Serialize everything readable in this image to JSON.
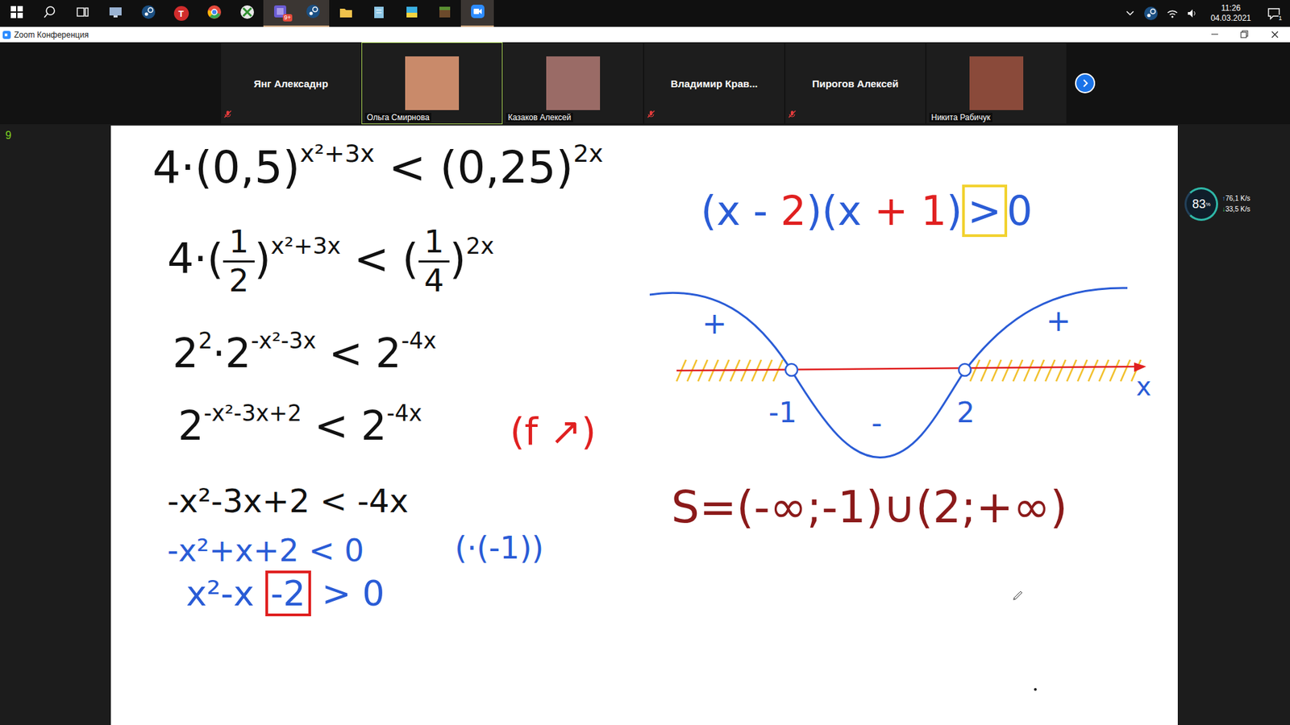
{
  "taskbar": {
    "apps": [
      {
        "kind": "start",
        "active": false
      },
      {
        "kind": "search",
        "active": false
      },
      {
        "kind": "taskview",
        "active": false
      },
      {
        "kind": "monitor",
        "active": false
      },
      {
        "kind": "steam",
        "active": false
      },
      {
        "kind": "letter",
        "label": "T",
        "active": false
      },
      {
        "kind": "chrome",
        "active": false
      },
      {
        "kind": "xbox",
        "active": false
      },
      {
        "kind": "badge",
        "badge": "9+",
        "active": true
      },
      {
        "kind": "steam",
        "active": true
      },
      {
        "kind": "folder",
        "active": false
      },
      {
        "kind": "notes",
        "active": false
      },
      {
        "kind": "paint",
        "active": false
      },
      {
        "kind": "block",
        "active": false
      },
      {
        "kind": "zoom",
        "active": true
      }
    ],
    "time": "11:26",
    "date": "04.03.2021",
    "notifications": "1"
  },
  "window": {
    "title": "Zoom Конференция"
  },
  "side_marker": "9",
  "participants": [
    {
      "name": "Янг Алексаднр",
      "video": false,
      "muted": true,
      "selected": false
    },
    {
      "name": "Ольга Смирнова",
      "video": true,
      "muted": false,
      "selected": true,
      "color": "#c98a6a"
    },
    {
      "name": "Казаков Алексей",
      "video": true,
      "muted": false,
      "selected": false,
      "color": "#9a6b66"
    },
    {
      "name": "Владимир  Крав...",
      "video": false,
      "muted": true,
      "selected": false
    },
    {
      "name": "Пирогов Алексей",
      "video": false,
      "muted": true,
      "selected": false
    },
    {
      "name": "Никита Рабичук",
      "video": true,
      "muted": false,
      "selected": false,
      "color": "#8a4a3a"
    }
  ],
  "network": {
    "percent": "83",
    "percent_sign": "%",
    "up_arrow": "↑",
    "up": "76,1 K/s",
    "down_arrow": "↓",
    "down": "33,5 K/s"
  },
  "board": {
    "items": [
      {
        "segments": [
          {
            "k": "base",
            "t": "4·(0,5)",
            "color": "#111111"
          },
          {
            "k": "sup",
            "t": "x²+3x",
            "color": "#111111"
          },
          {
            "k": "base",
            "t": " < (0,25)",
            "color": "#111111"
          },
          {
            "k": "sup",
            "t": "2x",
            "color": "#111111"
          }
        ]
      },
      {
        "segments": [
          {
            "k": "base",
            "t": "4·(",
            "color": "#111111"
          },
          {
            "k": "frac",
            "num": "1",
            "den": "2",
            "color": "#111111"
          },
          {
            "k": "base",
            "t": ")",
            "color": "#111111"
          },
          {
            "k": "sup",
            "t": "x²+3x",
            "color": "#111111"
          },
          {
            "k": "base",
            "t": "  < (",
            "color": "#111111"
          },
          {
            "k": "frac",
            "num": "1",
            "den": "4",
            "color": "#111111"
          },
          {
            "k": "base",
            "t": ")",
            "color": "#111111"
          },
          {
            "k": "sup",
            "t": "2x",
            "color": "#111111"
          }
        ]
      },
      {
        "segments": [
          {
            "k": "base",
            "t": "2",
            "color": "#111111"
          },
          {
            "k": "sup",
            "t": "2",
            "color": "#111111"
          },
          {
            "k": "base",
            "t": "·2",
            "color": "#111111"
          },
          {
            "k": "sup",
            "t": "-x²-3x",
            "color": "#111111"
          },
          {
            "k": "base",
            "t": "  < 2",
            "color": "#111111"
          },
          {
            "k": "sup",
            "t": "-4x",
            "color": "#111111"
          }
        ]
      },
      {
        "segments": [
          {
            "k": "base",
            "t": "2",
            "color": "#111111"
          },
          {
            "k": "sup",
            "t": "-x²-3x+2",
            "color": "#111111"
          },
          {
            "k": "base",
            "t": "   < 2",
            "color": "#111111"
          },
          {
            "k": "sup",
            "t": "-4x",
            "color": "#111111"
          }
        ]
      },
      {
        "segments": [
          {
            "k": "base",
            "t": "(f ↗)",
            "color": "#e02020"
          }
        ]
      },
      {
        "segments": [
          {
            "k": "base",
            "t": "-x²-3x+2 < -4x",
            "color": "#111111"
          }
        ]
      },
      {
        "segments": [
          {
            "k": "base",
            "t": "-x²+x+2 < 0",
            "color": "#2a5cd6"
          }
        ]
      },
      {
        "segments": [
          {
            "k": "base",
            "t": "(·(-1))",
            "color": "#2a5cd6"
          }
        ]
      },
      {
        "segments": [
          {
            "k": "base",
            "t": "x²-x ",
            "color": "#2a5cd6"
          },
          {
            "k": "box",
            "t": "-2",
            "color": "#2a5cd6",
            "box_color": "#e02020"
          },
          {
            "k": "base",
            "t": " > 0",
            "color": "#2a5cd6"
          }
        ]
      },
      {
        "segments": [
          {
            "k": "base",
            "t": "(x - ",
            "color": "#2a5cd6"
          },
          {
            "k": "base",
            "t": "2",
            "color": "#e02020"
          },
          {
            "k": "base",
            "t": ")(x ",
            "color": "#2a5cd6"
          },
          {
            "k": "base",
            "t": "+ 1",
            "color": "#e02020"
          },
          {
            "k": "base",
            "t": ")",
            "color": "#2a5cd6"
          },
          {
            "k": "box",
            "t": ">",
            "color": "#2a5cd6",
            "box_color": "#f2d230"
          },
          {
            "k": "base",
            "t": "0",
            "color": "#2a5cd6"
          }
        ]
      },
      {
        "segments": [
          {
            "k": "base",
            "t": "S=(-∞;-1)∪(2;+∞)",
            "color": "#8b1a1a"
          }
        ]
      }
    ],
    "graph": {
      "signs": [
        "+",
        "-",
        "+"
      ],
      "roots": [
        "-1",
        "2"
      ],
      "axis_label": "x"
    }
  }
}
